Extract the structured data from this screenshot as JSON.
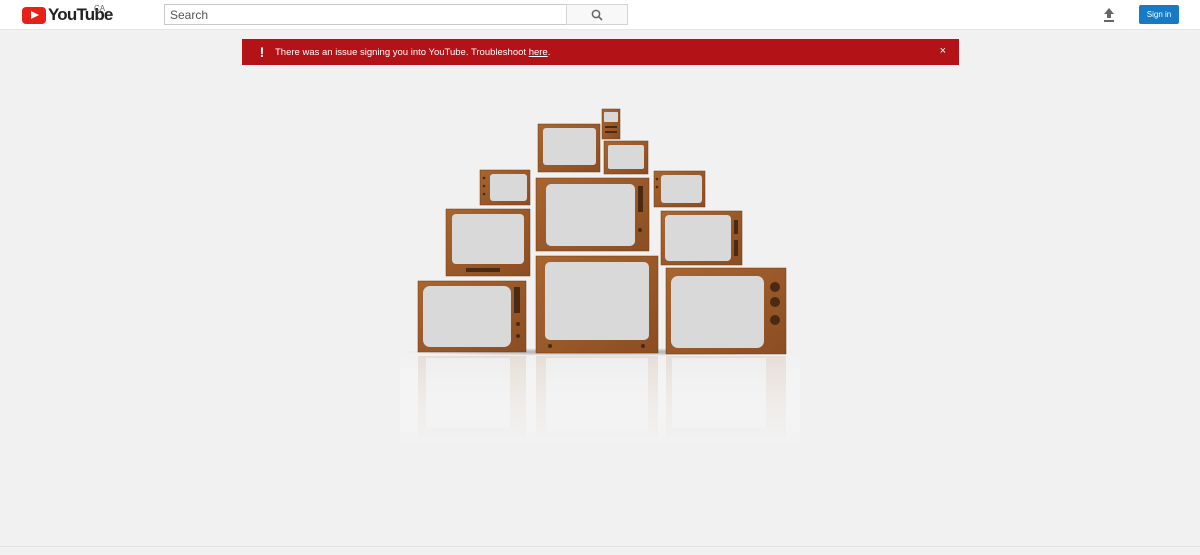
{
  "header": {
    "logo_text": "YouTube",
    "region": "CA",
    "search_placeholder": "Search",
    "signin_label": "Sign in"
  },
  "alert": {
    "message": "There was an issue signing you into YouTube. Troubleshoot ",
    "link_text": "here",
    "suffix": ".",
    "close": "×",
    "icon": "!"
  },
  "colors": {
    "brand_red": "#e62117",
    "alert_red": "#b31217",
    "signin_blue": "#167ac6",
    "wood": "#9a5a2c"
  },
  "icons": {
    "search": "search-icon",
    "upload": "upload-icon",
    "alert": "exclamation-icon",
    "close": "close-icon"
  }
}
